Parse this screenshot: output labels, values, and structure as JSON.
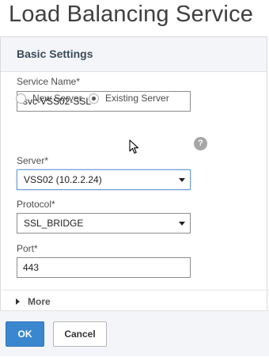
{
  "page": {
    "title": "Load Balancing Service"
  },
  "panel": {
    "title": "Basic Settings"
  },
  "service_name": {
    "label": "Service Name*",
    "value": "svc-VSS02-SSL"
  },
  "server_type": {
    "options": [
      {
        "label": "New Server",
        "checked": false
      },
      {
        "label": "Existing Server",
        "checked": true
      }
    ]
  },
  "server": {
    "label": "Server*",
    "value": "VSS02 (10.2.2.24)",
    "help": "?"
  },
  "protocol": {
    "label": "Protocol*",
    "value": "SSL_BRIDGE"
  },
  "port": {
    "label": "Port*",
    "value": "443"
  },
  "more": {
    "label": "More"
  },
  "buttons": {
    "ok": "OK",
    "cancel": "Cancel"
  },
  "colors": {
    "primary_button": "#3b87cf",
    "panel_header": "#f3f5f8",
    "focus_border": "#6d9ed6"
  }
}
